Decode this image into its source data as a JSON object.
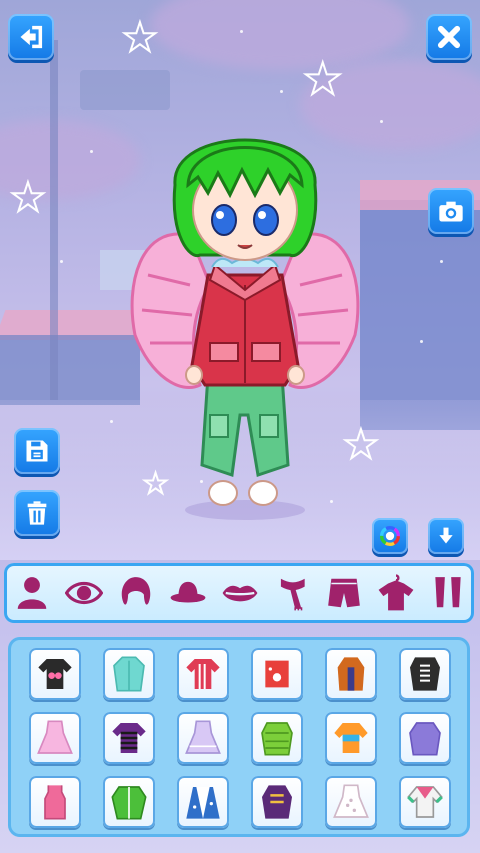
{
  "top_buttons": {
    "back": {
      "icon": "back-arrow-icon"
    },
    "close": {
      "icon": "close-icon"
    },
    "camera": {
      "icon": "camera-icon"
    }
  },
  "side_buttons": {
    "save": {
      "icon": "save-icon"
    },
    "delete": {
      "icon": "trash-icon"
    }
  },
  "tools": {
    "color": {
      "icon": "color-wheel-icon"
    },
    "download": {
      "icon": "download-arrow-icon"
    }
  },
  "categories": [
    {
      "id": "body",
      "icon": "person-icon"
    },
    {
      "id": "eyes",
      "icon": "eye-icon"
    },
    {
      "id": "hair",
      "icon": "hair-icon"
    },
    {
      "id": "hat",
      "icon": "hat-icon"
    },
    {
      "id": "mouth",
      "icon": "lips-icon"
    },
    {
      "id": "scarf",
      "icon": "scarf-icon"
    },
    {
      "id": "pants",
      "icon": "shorts-icon"
    },
    {
      "id": "tops",
      "icon": "hanger-shirt-icon"
    },
    {
      "id": "socks",
      "icon": "legwear-icon"
    }
  ],
  "items": [
    {
      "name": "black-pink-tee",
      "color": "#2a2a2a",
      "accent": "#ff6fa8"
    },
    {
      "name": "mint-coat",
      "color": "#6fd8d0",
      "accent": "#4bbab1"
    },
    {
      "name": "red-striped-top",
      "color": "#e03c55",
      "accent": "#ffffff"
    },
    {
      "name": "red-dot-shirt",
      "color": "#e8403b",
      "accent": "#ffffff"
    },
    {
      "name": "orange-longcoat",
      "color": "#d2691e",
      "accent": "#3b3b8a"
    },
    {
      "name": "black-military-jacket",
      "color": "#2d2d2d",
      "accent": "#ffffff"
    },
    {
      "name": "pink-dress",
      "color": "#f7b6e0",
      "accent": "#ffffff"
    },
    {
      "name": "purple-striped-tee",
      "color": "#6a2a8a",
      "accent": "#1a1a1a"
    },
    {
      "name": "lilac-frill-dress",
      "color": "#d8c8f5",
      "accent": "#ffffff"
    },
    {
      "name": "green-puffer",
      "color": "#7ccf3a",
      "accent": "#4e9a20"
    },
    {
      "name": "rainbow-sweater",
      "color": "#ff9a2a",
      "accent": "#35b3e8"
    },
    {
      "name": "purple-hoodie",
      "color": "#8b7ad9",
      "accent": "#6a58c0"
    },
    {
      "name": "pink-tank",
      "color": "#ef6a9a",
      "accent": "#ffb8d0"
    },
    {
      "name": "green-zip-jacket",
      "color": "#4cbf3a",
      "accent": "#ffffff"
    },
    {
      "name": "blue-star-cape",
      "color": "#2f6fc9",
      "accent": "#ffffff"
    },
    {
      "name": "purple-gold-coat",
      "color": "#5a2a78",
      "accent": "#f0c040"
    },
    {
      "name": "white-dot-dress",
      "color": "#ffffff",
      "accent": "#d0b8c8"
    },
    {
      "name": "pink-green-blouse",
      "color": "#f3f3f3",
      "accent": "#e85c8a"
    }
  ],
  "character": {
    "hair_color": "#2ed12a",
    "eye_color": "#2d6ee0",
    "jacket_color": "#d9344a",
    "pants_color": "#5fc98a",
    "wing_color": "#f7b0d8"
  }
}
